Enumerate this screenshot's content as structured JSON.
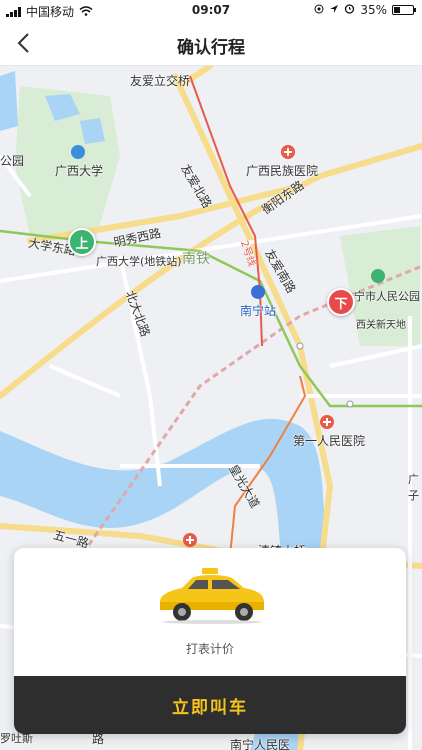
{
  "status_bar": {
    "carrier": "中国移动",
    "time": "09:07",
    "battery_percent": "35%",
    "battery_level": 0.35
  },
  "nav": {
    "title": "确认行程"
  },
  "map": {
    "labels": {
      "youai_bridge": "友爱立交桥",
      "guangxi_univ": "广西大学",
      "minzu_hospital": "广西民族医院",
      "youai_north": "友爱北路",
      "line2": "2号线",
      "hengyang_east": "衡阳东路",
      "mingxiu_west": "明秀西路",
      "daxue_east": "大学东路",
      "station_metro": "广西大学(地铁站)",
      "nantie": "南铁",
      "youai_south": "友爱南路",
      "park": "宁市人民公园",
      "xiguan": "西关新天地",
      "nanning_station": "南宁站",
      "beida_north": "北大北路",
      "first_hospital": "第一人民医院",
      "huangguan": "皇光大道",
      "wuyi": "五一路",
      "qingjing": "清镇大桥",
      "gongyuan": "公园",
      "guang": "广子",
      "lu": "路",
      "luo": "罗吐斯",
      "bottom": "南宁人民医"
    },
    "markers": {
      "start": "上",
      "end": "下"
    }
  },
  "card": {
    "fare_type": "打表计价",
    "call_button": "立即叫车"
  },
  "colors": {
    "accent": "#f5c518",
    "start_marker": "#3cb371",
    "end_marker": "#e84a4a",
    "button_bg": "#2e2e2e"
  }
}
